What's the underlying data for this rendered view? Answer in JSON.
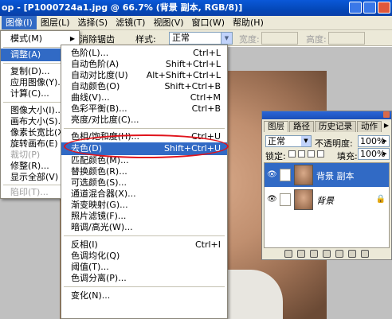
{
  "titlebar": {
    "text": "op - [P1000724a1.jpg @ 66.7% (背景 副本, RGB/8)]"
  },
  "menubar": {
    "items": [
      "图像(I)",
      "图层(L)",
      "选择(S)",
      "滤镜(T)",
      "视图(V)",
      "窗口(W)",
      "帮助(H)"
    ]
  },
  "optbar": {
    "clear_label": "消除锯齿",
    "style_label": "样式:",
    "style_value": "正常",
    "width_label": "宽度:",
    "height_label": "高度:"
  },
  "image_menu": {
    "items": [
      {
        "label": "模式(M)",
        "submenu": true
      },
      {
        "label": "调整(A)",
        "submenu": true,
        "highlight": true
      },
      {
        "label": "复制(D)..."
      },
      {
        "label": "应用图像(Y)..."
      },
      {
        "label": "计算(C)..."
      },
      {
        "label": "图像大小(I)..."
      },
      {
        "label": "画布大小(S)..."
      },
      {
        "label": "像素长宽比(X)",
        "submenu": true
      },
      {
        "label": "旋转画布(E)",
        "submenu": true
      },
      {
        "label": "裁切(P)",
        "disabled": true
      },
      {
        "label": "修整(R)..."
      },
      {
        "label": "显示全部(V)"
      },
      {
        "label": "陷印(T)...",
        "disabled": true
      }
    ]
  },
  "adjust_menu": {
    "items": [
      {
        "label": "色阶(L)...",
        "shortcut": "Ctrl+L"
      },
      {
        "label": "自动色阶(A)",
        "shortcut": "Shift+Ctrl+L"
      },
      {
        "label": "自动对比度(U)",
        "shortcut": "Alt+Shift+Ctrl+L"
      },
      {
        "label": "自动颜色(O)",
        "shortcut": "Shift+Ctrl+B"
      },
      {
        "label": "曲线(V)...",
        "shortcut": "Ctrl+M"
      },
      {
        "label": "色彩平衡(B)...",
        "shortcut": "Ctrl+B"
      },
      {
        "label": "亮度/对比度(C)..."
      },
      {
        "label": "色相/饱和度(H)...",
        "shortcut": "Ctrl+U"
      },
      {
        "label": "去色(D)",
        "shortcut": "Shift+Ctrl+U",
        "highlight": true
      },
      {
        "label": "匹配颜色(M)..."
      },
      {
        "label": "替换颜色(R)..."
      },
      {
        "label": "可选颜色(S)..."
      },
      {
        "label": "通道混合器(X)..."
      },
      {
        "label": "渐变映射(G)..."
      },
      {
        "label": "照片滤镜(F)..."
      },
      {
        "label": "暗调/高光(W)..."
      },
      {
        "label": "反相(I)",
        "shortcut": "Ctrl+I"
      },
      {
        "label": "色调均化(Q)"
      },
      {
        "label": "阈值(T)..."
      },
      {
        "label": "色调分离(P)..."
      },
      {
        "label": "变化(N)..."
      }
    ]
  },
  "layers_panel": {
    "tabs": [
      "图层",
      "路径",
      "历史记录",
      "动作"
    ],
    "blend_mode": "正常",
    "opacity_label": "不透明度:",
    "opacity_value": "100%",
    "lock_label": "锁定:",
    "fill_label": "填充:",
    "fill_value": "100%",
    "layers": [
      {
        "name": "背景 副本",
        "selected": true
      },
      {
        "name": "背景",
        "selected": false
      }
    ]
  },
  "colors": {
    "highlight": "#316ac5",
    "annotation": "#e0141c"
  }
}
